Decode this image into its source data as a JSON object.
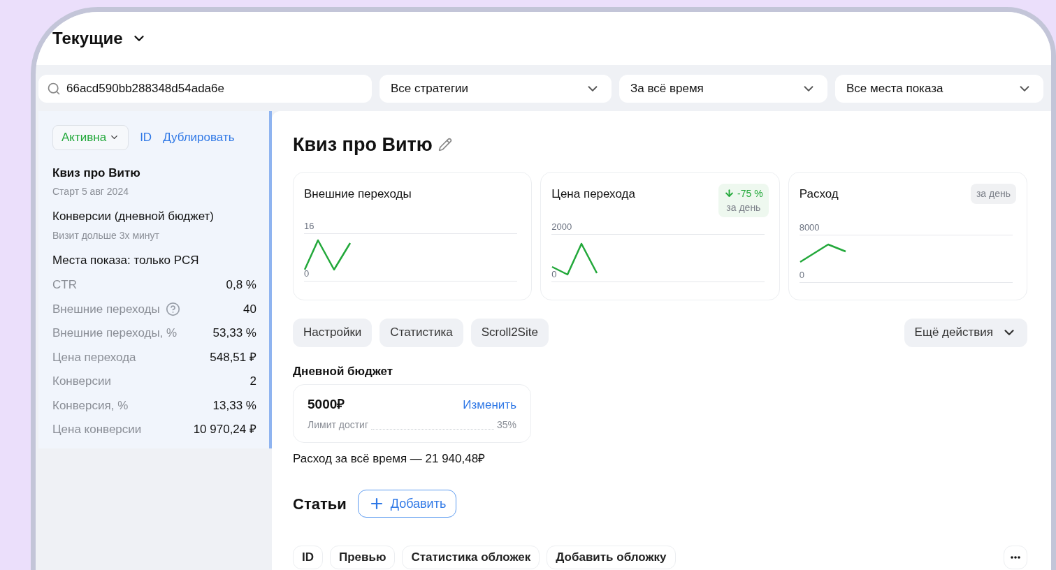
{
  "header": {
    "title": "Текущие"
  },
  "filters": {
    "search": {
      "value": "66acd590bb288348d54ada6e"
    },
    "selects": [
      {
        "value": "Все стратегии"
      },
      {
        "value": "За всё время"
      },
      {
        "value": "Все места показа"
      }
    ]
  },
  "sidebar": {
    "status": "Активна",
    "links": [
      "ID",
      "Дублировать"
    ],
    "name": "Квиз про Витю",
    "start": "Старт 5 авг 2024",
    "strategy": "Конверсии (дневной бюджет)",
    "goal": "Визит дольше 3х минут",
    "placements": "Места показа: только РСЯ",
    "metrics": [
      {
        "label": "CTR",
        "value": "0,8 %",
        "help": false
      },
      {
        "label": "Внешние переходы",
        "value": "40",
        "help": true
      },
      {
        "label": "Внешние переходы, %",
        "value": "53,33 %",
        "help": false
      },
      {
        "label": "Цена перехода",
        "value": "548,51 ₽",
        "help": false
      },
      {
        "label": "Конверсии",
        "value": "2",
        "help": false
      },
      {
        "label": "Конверсия, %",
        "value": "13,33 %",
        "help": false
      },
      {
        "label": "Цена конверсии",
        "value": "10 970,24 ₽",
        "help": false
      }
    ]
  },
  "main": {
    "title": "Квиз про Витю",
    "cards": [
      {
        "title": "Внешние переходы",
        "sparkline": {
          "kind": "zigzag",
          "top_label": "16",
          "bottom_label": "0"
        }
      },
      {
        "title": "Цена перехода",
        "badge": {
          "kind": "delta",
          "value": "-75 %",
          "period": "за день"
        },
        "sparkline": {
          "kind": "dip-peak",
          "top_label": "2000",
          "bottom_label": "0"
        }
      },
      {
        "title": "Расход",
        "badge": {
          "kind": "period",
          "period": "за день"
        },
        "sparkline": {
          "kind": "hill",
          "top_label": "8000",
          "bottom_label": "0"
        }
      }
    ],
    "tabs": [
      "Настройки",
      "Статистика",
      "Scroll2Site"
    ],
    "more_actions": "Ещё действия",
    "budget": {
      "heading": "Дневной бюджет",
      "amount": "5000₽",
      "change": "Изменить",
      "limit_label": "Лимит достиг",
      "limit_value": "35%",
      "total": "Расход за всё время — 21 940,48₽"
    },
    "articles": {
      "heading": "Статьи",
      "add": "Добавить",
      "columns": [
        "ID",
        "Превью",
        "Статистика обложек",
        "Добавить обложку"
      ]
    }
  }
}
